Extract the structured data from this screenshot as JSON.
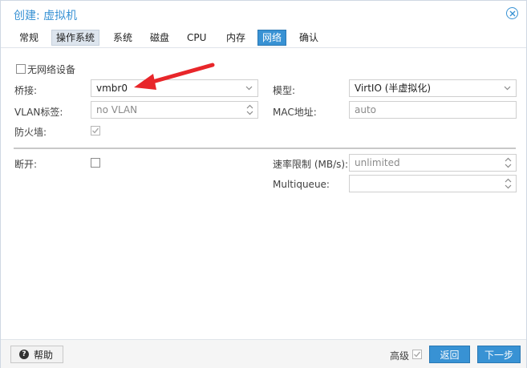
{
  "dialog": {
    "title": "创建: 虚拟机"
  },
  "tabs": [
    {
      "label": "常规"
    },
    {
      "label": "操作系统"
    },
    {
      "label": "系统"
    },
    {
      "label": "磁盘"
    },
    {
      "label": "CPU"
    },
    {
      "label": "内存"
    },
    {
      "label": "网络"
    },
    {
      "label": "确认"
    }
  ],
  "form": {
    "no_network_label": "无网络设备",
    "bridge_label": "桥接:",
    "bridge_value": "vmbr0",
    "vlan_label": "VLAN标签:",
    "vlan_placeholder": "no VLAN",
    "firewall_label": "防火墙:",
    "model_label": "模型:",
    "model_value": "VirtIO (半虚拟化)",
    "mac_label": "MAC地址:",
    "mac_value": "auto",
    "disconnect_label": "断开:",
    "rate_label": "速率限制 (MB/s):",
    "rate_placeholder": "unlimited",
    "multiqueue_label": "Multiqueue:",
    "multiqueue_value": ""
  },
  "footer": {
    "help_label": "帮助",
    "advanced_label": "高级",
    "back_label": "返回",
    "next_label": "下一步"
  },
  "colors": {
    "accent": "#3892d4",
    "annotation_arrow": "#e8262a"
  }
}
